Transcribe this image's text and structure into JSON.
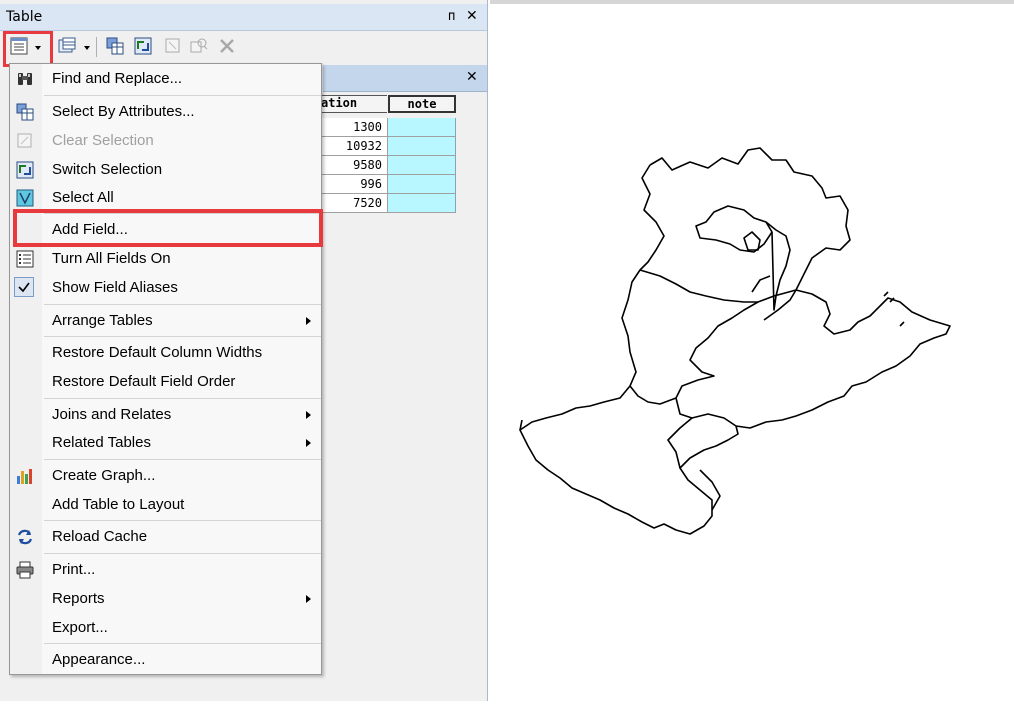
{
  "table_window": {
    "title": "Table",
    "pin_glyph": "ᴨ",
    "close_glyph": "✕"
  },
  "subtab": {
    "close_glyph": "✕"
  },
  "grid": {
    "columns": [
      "ation",
      "note"
    ],
    "rows": [
      "1300",
      "10932",
      "9580",
      "996",
      "7520"
    ]
  },
  "menu": {
    "items": [
      {
        "label": "Find and Replace...",
        "icon": "binoculars-icon"
      },
      {
        "label": "Select By Attributes...",
        "icon": "select-by-attributes-icon"
      },
      {
        "label": "Clear Selection",
        "icon": "clear-selection-icon"
      },
      {
        "label": "Switch Selection",
        "icon": "switch-selection-icon"
      },
      {
        "label": "Select All",
        "icon": "select-all-icon"
      },
      {
        "label": "Add Field...",
        "icon": ""
      },
      {
        "label": "Turn All Fields On",
        "icon": "fields-list-icon"
      },
      {
        "label": "Show Field Aliases",
        "icon": "checkmark-icon"
      },
      {
        "label": "Arrange Tables",
        "icon": ""
      },
      {
        "label": "Restore Default Column Widths",
        "icon": ""
      },
      {
        "label": "Restore Default Field Order",
        "icon": ""
      },
      {
        "label": "Joins and Relates",
        "icon": ""
      },
      {
        "label": "Related Tables",
        "icon": ""
      },
      {
        "label": "Create Graph...",
        "icon": "bar-graph-icon"
      },
      {
        "label": "Add Table to Layout",
        "icon": ""
      },
      {
        "label": "Reload Cache",
        "icon": "reload-icon"
      },
      {
        "label": "Print...",
        "icon": "printer-icon"
      },
      {
        "label": "Reports",
        "icon": ""
      },
      {
        "label": "Export...",
        "icon": ""
      },
      {
        "label": "Appearance...",
        "icon": ""
      }
    ]
  },
  "colors": {
    "highlight": "#e8393f",
    "note_cell": "#b8f7ff",
    "title_bar": "#dbe6f4"
  }
}
